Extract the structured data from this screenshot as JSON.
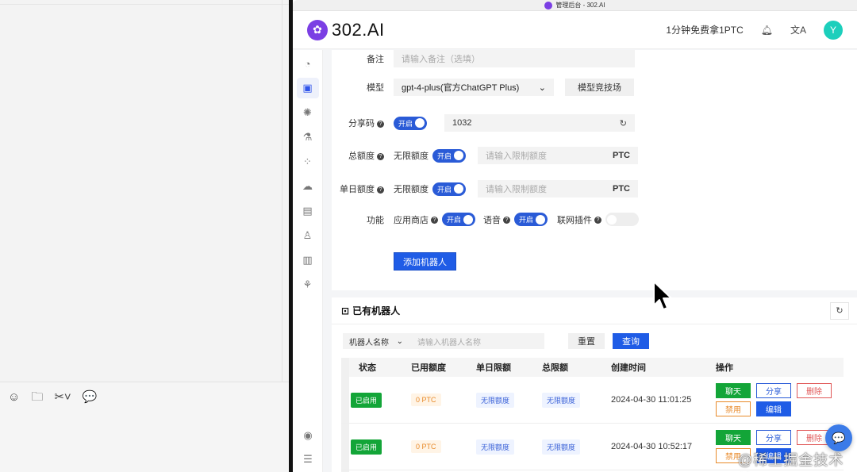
{
  "window": {
    "title": "管理后台 - 302.AI"
  },
  "header": {
    "logo_text": "302.AI",
    "promo": "1分钟免费拿1PTC",
    "avatar": "Y"
  },
  "left_toolbar": {
    "icons": [
      "emoji-icon",
      "folder-icon",
      "scissors-icon",
      "chat-bubble-icon"
    ]
  },
  "form": {
    "note": {
      "label": "备注",
      "placeholder": "请输入备注（选填）"
    },
    "model": {
      "label": "模型",
      "value": "gpt-4-plus(官方ChatGPT Plus)",
      "arena_button": "模型竞技场"
    },
    "share_code": {
      "label": "分享码",
      "toggle": "开启",
      "value": "1032"
    },
    "total_quota": {
      "label": "总额度",
      "unlimited_label": "无限额度",
      "toggle": "开启",
      "placeholder": "请输入限制额度",
      "unit": "PTC"
    },
    "daily_quota": {
      "label": "单日额度",
      "unlimited_label": "无限额度",
      "toggle": "开启",
      "placeholder": "请输入限制额度",
      "unit": "PTC"
    },
    "features": {
      "label": "功能",
      "app_store_label": "应用商店",
      "app_store_toggle": "开启",
      "voice_label": "语音",
      "voice_toggle": "开启",
      "web_plugin_label": "联网插件"
    },
    "submit": "添加机器人"
  },
  "list": {
    "title": "已有机器人",
    "filter_select": "机器人名称",
    "filter_placeholder": "请输入机器人名称",
    "reset": "重置",
    "query": "查询",
    "columns": [
      "状态",
      "已用额度",
      "单日限额",
      "总限额",
      "创建时间",
      "操作"
    ],
    "rows": [
      {
        "status": "已启用",
        "used": "0 PTC",
        "daily": "无限额度",
        "total": "无限额度",
        "created": "2024-04-30 11:01:25"
      },
      {
        "status": "已启用",
        "used": "0 PTC",
        "daily": "无限额度",
        "total": "无限额度",
        "created": "2024-04-30 10:52:17"
      }
    ],
    "actions": {
      "chat": "聊天",
      "share": "分享",
      "delete": "删除",
      "disable": "禁用",
      "edit": "编辑"
    }
  },
  "watermark": "@稀土掘金技术社区"
}
